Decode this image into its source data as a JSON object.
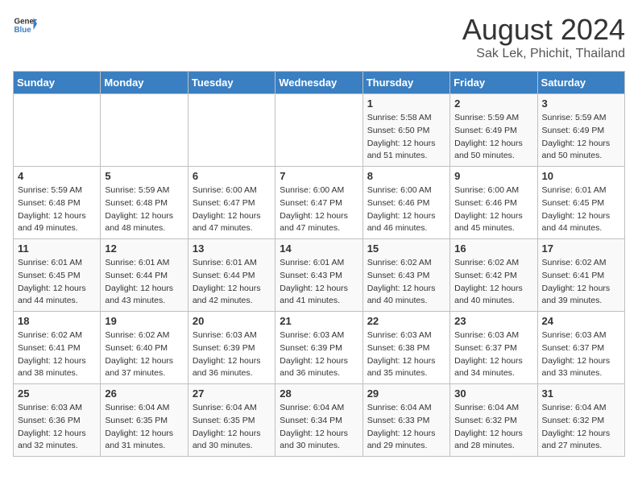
{
  "header": {
    "logo_general": "General",
    "logo_blue": "Blue",
    "title": "August 2024",
    "subtitle": "Sak Lek, Phichit, Thailand"
  },
  "days_of_week": [
    "Sunday",
    "Monday",
    "Tuesday",
    "Wednesday",
    "Thursday",
    "Friday",
    "Saturday"
  ],
  "weeks": [
    [
      {
        "day": "",
        "info": ""
      },
      {
        "day": "",
        "info": ""
      },
      {
        "day": "",
        "info": ""
      },
      {
        "day": "",
        "info": ""
      },
      {
        "day": "1",
        "info": "Sunrise: 5:58 AM\nSunset: 6:50 PM\nDaylight: 12 hours\nand 51 minutes."
      },
      {
        "day": "2",
        "info": "Sunrise: 5:59 AM\nSunset: 6:49 PM\nDaylight: 12 hours\nand 50 minutes."
      },
      {
        "day": "3",
        "info": "Sunrise: 5:59 AM\nSunset: 6:49 PM\nDaylight: 12 hours\nand 50 minutes."
      }
    ],
    [
      {
        "day": "4",
        "info": "Sunrise: 5:59 AM\nSunset: 6:48 PM\nDaylight: 12 hours\nand 49 minutes."
      },
      {
        "day": "5",
        "info": "Sunrise: 5:59 AM\nSunset: 6:48 PM\nDaylight: 12 hours\nand 48 minutes."
      },
      {
        "day": "6",
        "info": "Sunrise: 6:00 AM\nSunset: 6:47 PM\nDaylight: 12 hours\nand 47 minutes."
      },
      {
        "day": "7",
        "info": "Sunrise: 6:00 AM\nSunset: 6:47 PM\nDaylight: 12 hours\nand 47 minutes."
      },
      {
        "day": "8",
        "info": "Sunrise: 6:00 AM\nSunset: 6:46 PM\nDaylight: 12 hours\nand 46 minutes."
      },
      {
        "day": "9",
        "info": "Sunrise: 6:00 AM\nSunset: 6:46 PM\nDaylight: 12 hours\nand 45 minutes."
      },
      {
        "day": "10",
        "info": "Sunrise: 6:01 AM\nSunset: 6:45 PM\nDaylight: 12 hours\nand 44 minutes."
      }
    ],
    [
      {
        "day": "11",
        "info": "Sunrise: 6:01 AM\nSunset: 6:45 PM\nDaylight: 12 hours\nand 44 minutes."
      },
      {
        "day": "12",
        "info": "Sunrise: 6:01 AM\nSunset: 6:44 PM\nDaylight: 12 hours\nand 43 minutes."
      },
      {
        "day": "13",
        "info": "Sunrise: 6:01 AM\nSunset: 6:44 PM\nDaylight: 12 hours\nand 42 minutes."
      },
      {
        "day": "14",
        "info": "Sunrise: 6:01 AM\nSunset: 6:43 PM\nDaylight: 12 hours\nand 41 minutes."
      },
      {
        "day": "15",
        "info": "Sunrise: 6:02 AM\nSunset: 6:43 PM\nDaylight: 12 hours\nand 40 minutes."
      },
      {
        "day": "16",
        "info": "Sunrise: 6:02 AM\nSunset: 6:42 PM\nDaylight: 12 hours\nand 40 minutes."
      },
      {
        "day": "17",
        "info": "Sunrise: 6:02 AM\nSunset: 6:41 PM\nDaylight: 12 hours\nand 39 minutes."
      }
    ],
    [
      {
        "day": "18",
        "info": "Sunrise: 6:02 AM\nSunset: 6:41 PM\nDaylight: 12 hours\nand 38 minutes."
      },
      {
        "day": "19",
        "info": "Sunrise: 6:02 AM\nSunset: 6:40 PM\nDaylight: 12 hours\nand 37 minutes."
      },
      {
        "day": "20",
        "info": "Sunrise: 6:03 AM\nSunset: 6:39 PM\nDaylight: 12 hours\nand 36 minutes."
      },
      {
        "day": "21",
        "info": "Sunrise: 6:03 AM\nSunset: 6:39 PM\nDaylight: 12 hours\nand 36 minutes."
      },
      {
        "day": "22",
        "info": "Sunrise: 6:03 AM\nSunset: 6:38 PM\nDaylight: 12 hours\nand 35 minutes."
      },
      {
        "day": "23",
        "info": "Sunrise: 6:03 AM\nSunset: 6:37 PM\nDaylight: 12 hours\nand 34 minutes."
      },
      {
        "day": "24",
        "info": "Sunrise: 6:03 AM\nSunset: 6:37 PM\nDaylight: 12 hours\nand 33 minutes."
      }
    ],
    [
      {
        "day": "25",
        "info": "Sunrise: 6:03 AM\nSunset: 6:36 PM\nDaylight: 12 hours\nand 32 minutes."
      },
      {
        "day": "26",
        "info": "Sunrise: 6:04 AM\nSunset: 6:35 PM\nDaylight: 12 hours\nand 31 minutes."
      },
      {
        "day": "27",
        "info": "Sunrise: 6:04 AM\nSunset: 6:35 PM\nDaylight: 12 hours\nand 30 minutes."
      },
      {
        "day": "28",
        "info": "Sunrise: 6:04 AM\nSunset: 6:34 PM\nDaylight: 12 hours\nand 30 minutes."
      },
      {
        "day": "29",
        "info": "Sunrise: 6:04 AM\nSunset: 6:33 PM\nDaylight: 12 hours\nand 29 minutes."
      },
      {
        "day": "30",
        "info": "Sunrise: 6:04 AM\nSunset: 6:32 PM\nDaylight: 12 hours\nand 28 minutes."
      },
      {
        "day": "31",
        "info": "Sunrise: 6:04 AM\nSunset: 6:32 PM\nDaylight: 12 hours\nand 27 minutes."
      }
    ]
  ]
}
